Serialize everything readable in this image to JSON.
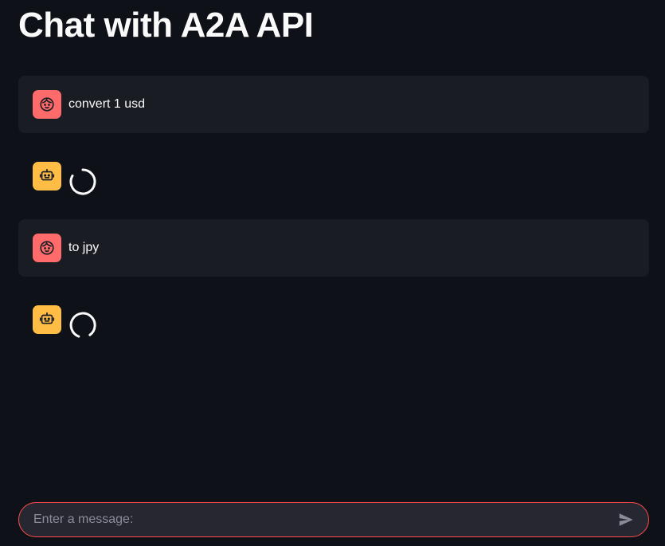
{
  "page": {
    "title": "Chat with A2A API"
  },
  "messages": [
    {
      "role": "user",
      "avatar_icon": "user-face-icon",
      "text": "convert 1 usd"
    },
    {
      "role": "assistant",
      "avatar_icon": "robot-icon",
      "status": "loading"
    },
    {
      "role": "user",
      "avatar_icon": "user-face-icon",
      "text": "to jpy"
    },
    {
      "role": "assistant",
      "avatar_icon": "robot-icon",
      "status": "loading"
    }
  ],
  "chat_input": {
    "placeholder": "Enter a message:",
    "value": "",
    "send_icon": "send-icon"
  },
  "colors": {
    "background": "#0e1117",
    "user_message_bg": "#1a1c24",
    "user_avatar": "#ff6b6b",
    "assistant_avatar": "#ffbd45",
    "input_border": "#ff4b4b",
    "input_bg": "#262730"
  }
}
